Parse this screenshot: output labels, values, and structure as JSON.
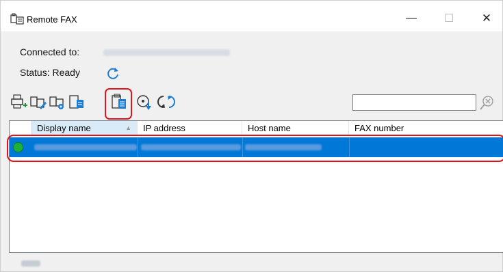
{
  "window": {
    "title": "Remote FAX",
    "controls": {
      "minimize": "—",
      "maximize": "☐",
      "close": "✕"
    }
  },
  "info": {
    "connected_label": "Connected to:",
    "status_label": "Status:",
    "status_value": "Ready"
  },
  "toolbar": {
    "icons": [
      "add-printer-icon",
      "edit-fax-icon",
      "fax-settings-icon",
      "fax-list-icon",
      "fax-list-selected-icon",
      "download-icon",
      "sync-icon"
    ]
  },
  "search": {
    "value": ""
  },
  "list": {
    "columns": [
      "",
      "Display name",
      "IP address",
      "Host name",
      "FAX number"
    ],
    "sort_indicator": "▲",
    "rows": [
      {
        "status": "online",
        "display_name": "",
        "ip_address": "",
        "host_name": "",
        "fax_number": ""
      }
    ]
  },
  "colors": {
    "selection": "#0078d7",
    "highlight_outline": "#e0131a",
    "online_dot": "#1db03a",
    "accent_icon": "#1a7fd4"
  }
}
